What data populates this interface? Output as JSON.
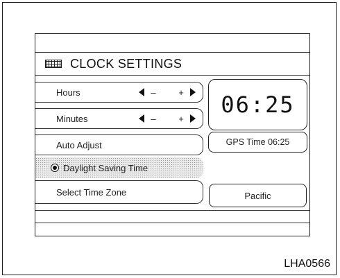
{
  "header": {
    "title": "CLOCK SETTINGS",
    "icon": "clock-settings-icon"
  },
  "menu": {
    "hours": {
      "label": "Hours",
      "decrease": "–",
      "increase": "+"
    },
    "minutes": {
      "label": "Minutes",
      "decrease": "–",
      "increase": "+"
    },
    "auto_adjust": {
      "label": "Auto Adjust"
    },
    "daylight_saving": {
      "label": "Daylight Saving Time",
      "selected": true
    },
    "time_zone": {
      "label": "Select Time Zone"
    }
  },
  "display": {
    "time": "06:25",
    "gps_time": "GPS Time  06:25",
    "time_zone_value": "Pacific"
  },
  "figure_id": "LHA0566"
}
